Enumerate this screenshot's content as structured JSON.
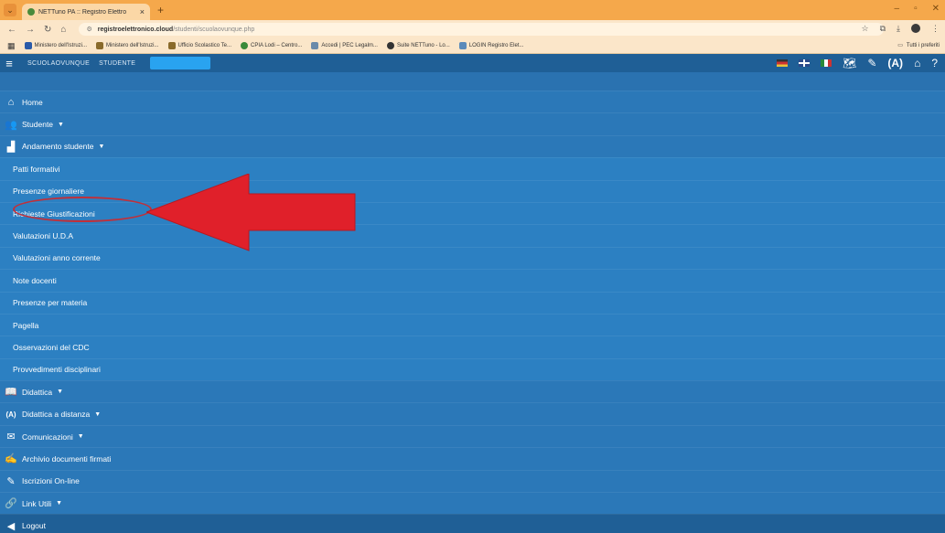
{
  "browser": {
    "tab_title": "NETTuno PA :: Registro Elettro",
    "tab_close": "×",
    "new_tab": "+",
    "url_domain": "registroelettronico.cloud",
    "url_path": "/studenti/scuolaovunque.php",
    "bookmarks": [
      "Ministero dell'Istruzi...",
      "Ministero dell'Istruzi...",
      "Ufficio Scolastico Te...",
      "CPIA Lodi – Centro...",
      "Accedi | PEC Legalm...",
      "Suite NETTuno - Lo...",
      "LOGIN Registro Elet..."
    ],
    "bookmarks_right": "Tutti i preferiti"
  },
  "header": {
    "item1": "SCUOLAOVUNQUE",
    "item2": "STUDENTE"
  },
  "menu": {
    "home": "Home",
    "studente": "Studente",
    "andamento": "Andamento studente",
    "subitems": [
      "Patti formativi",
      "Presenze giornaliere",
      "Richieste Giustificazioni",
      "Valutazioni U.D.A",
      "Valutazioni anno corrente",
      "Note docenti",
      "Presenze per materia",
      "Pagella",
      "Osservazioni del CDC",
      "Provvedimenti disciplinari"
    ],
    "didattica": "Didattica",
    "dad": "Didattica a distanza",
    "comunicazioni": "Comunicazioni",
    "archivio": "Archivio documenti firmati",
    "iscrizioni": "Iscrizioni On-line",
    "link": "Link Utili",
    "logout": "Logout"
  },
  "colors": {
    "menu_bg": "#2b78b8",
    "header_bg": "#1f5f96",
    "annotation_red": "#e0202a"
  }
}
